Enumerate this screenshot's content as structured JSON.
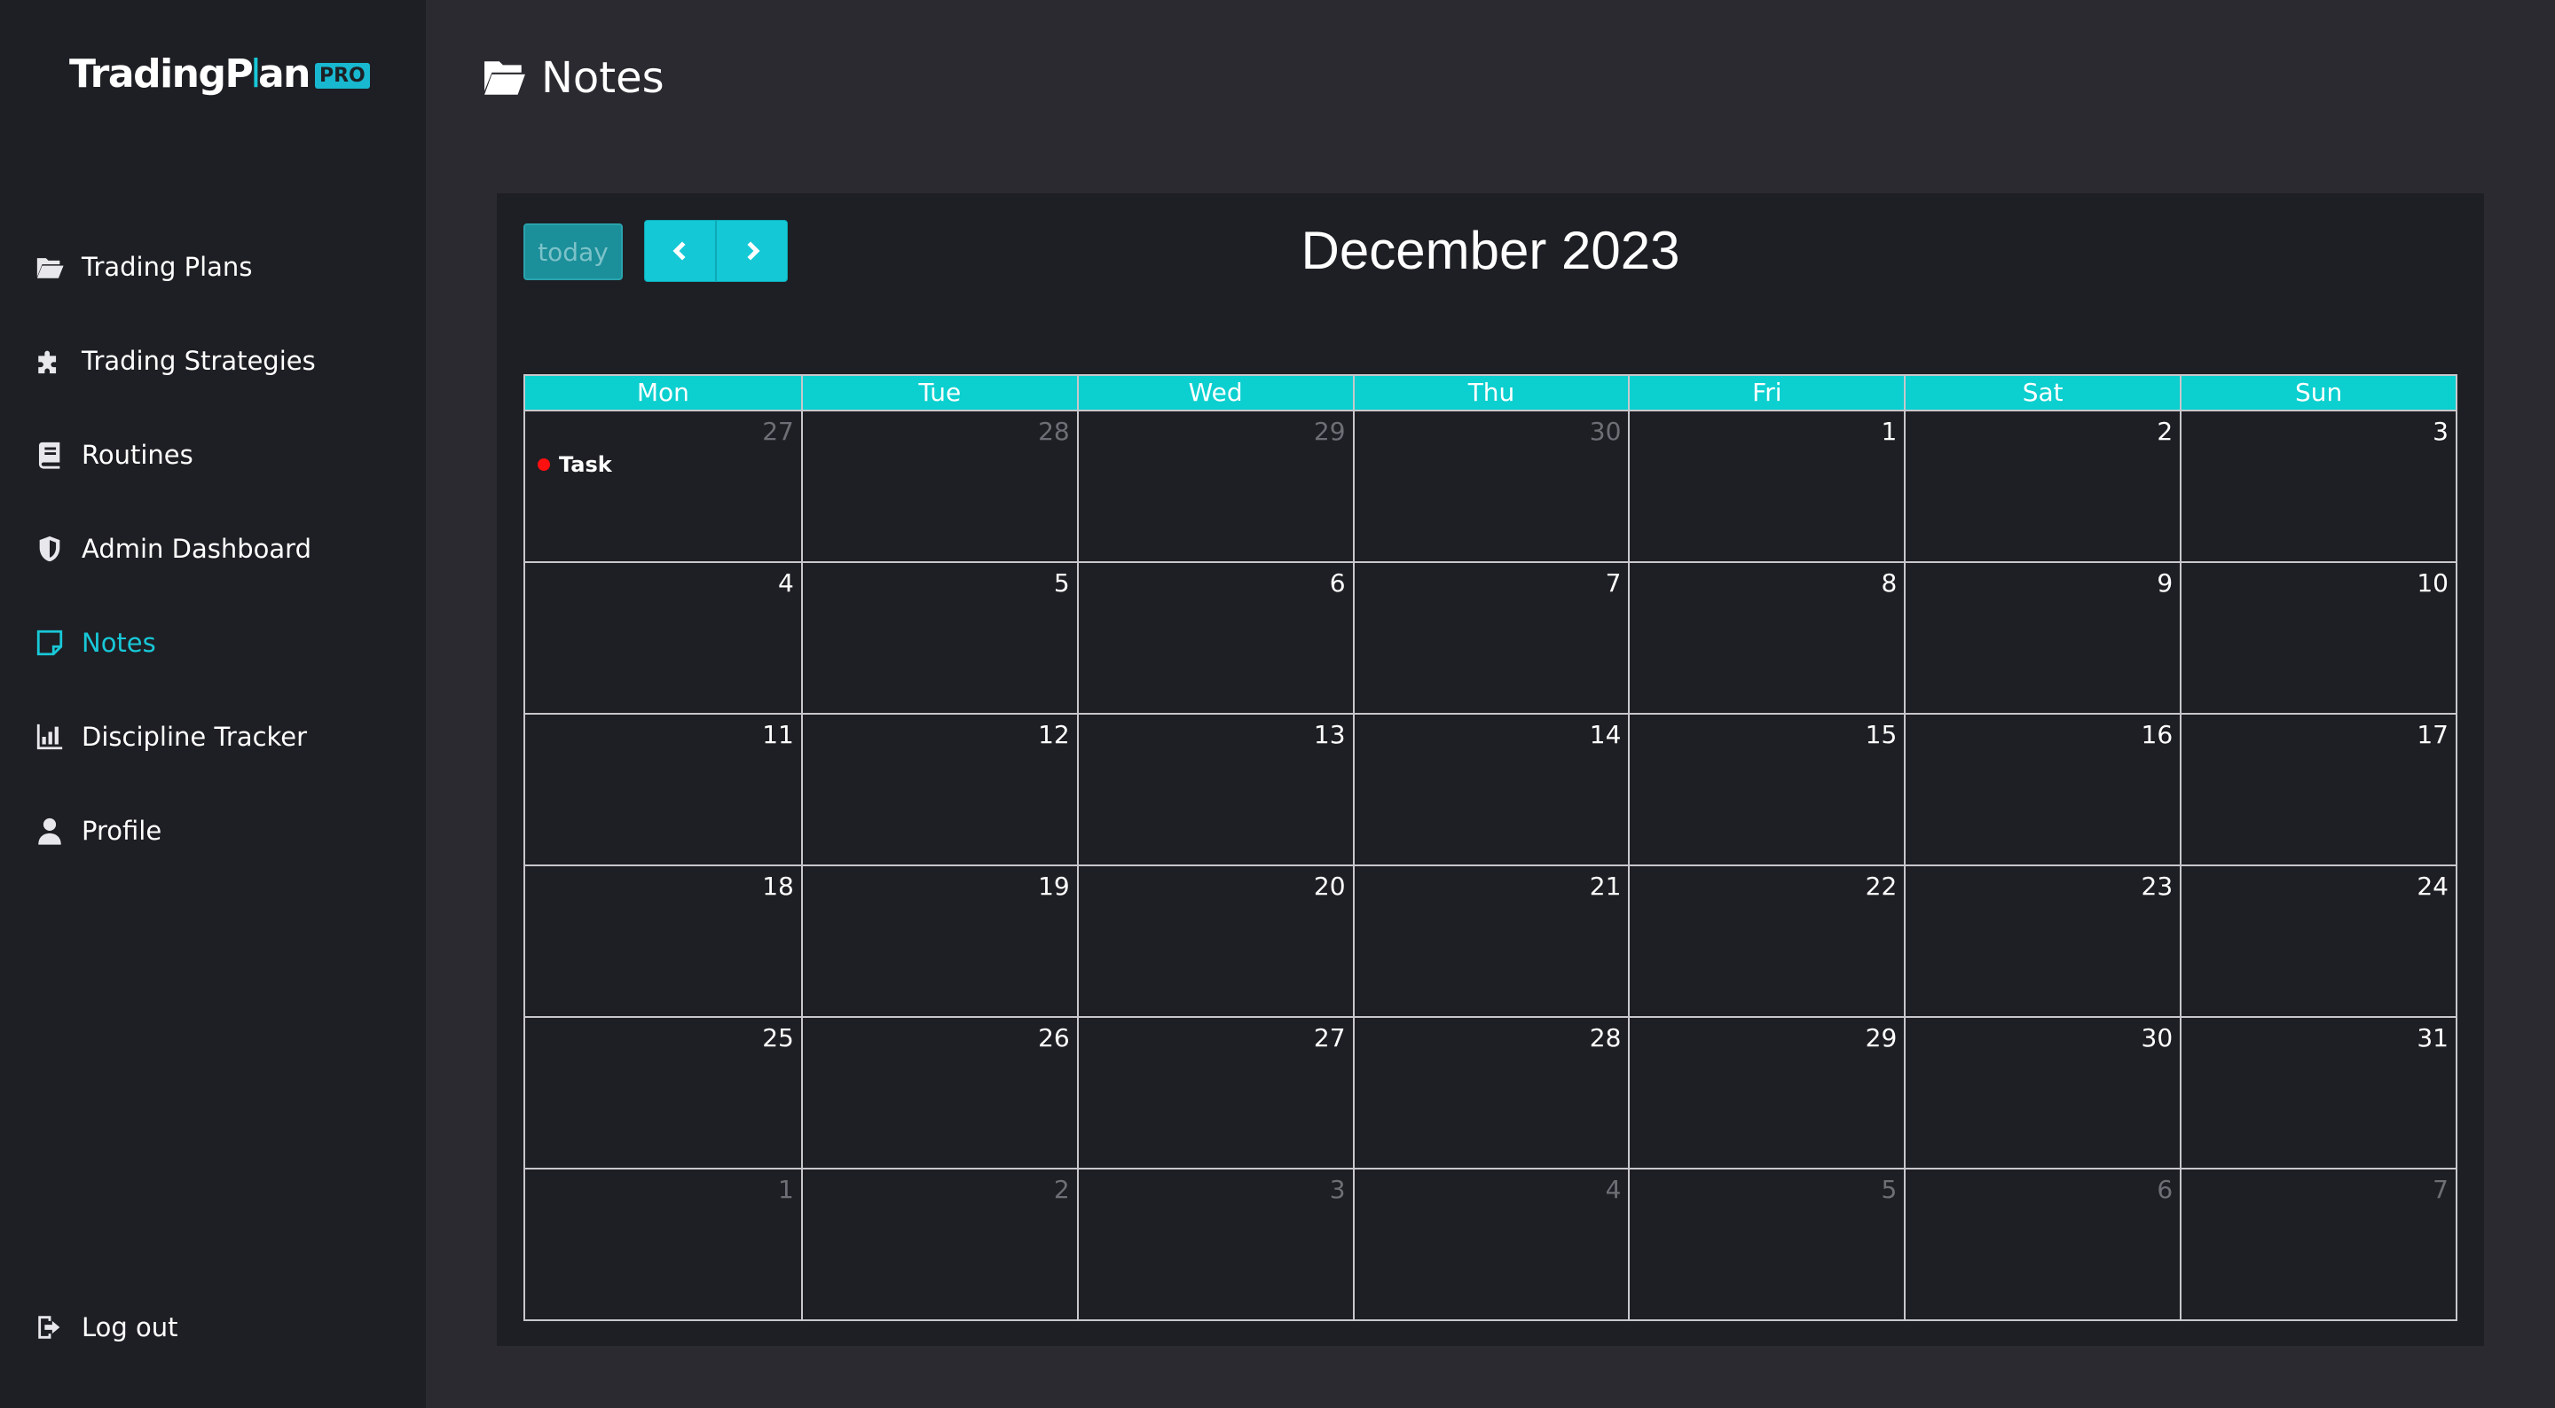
{
  "logo": {
    "text_a": "TradingP",
    "text_b": "l",
    "text_c": "an",
    "badge": "PRO"
  },
  "sidebar": {
    "items": [
      {
        "label": "Trading Plans",
        "icon": "folder-open-icon"
      },
      {
        "label": "Trading Strategies",
        "icon": "puzzle-icon"
      },
      {
        "label": "Routines",
        "icon": "book-icon"
      },
      {
        "label": "Admin Dashboard",
        "icon": "shield-icon"
      },
      {
        "label": "Notes",
        "icon": "note-icon",
        "active": true
      },
      {
        "label": "Discipline Tracker",
        "icon": "bar-chart-icon"
      },
      {
        "label": "Profile",
        "icon": "user-icon"
      }
    ],
    "logout_label": "Log out"
  },
  "header": {
    "title": "Notes"
  },
  "calendar": {
    "today_label": "today",
    "title": "December 2023",
    "weekdays": [
      "Mon",
      "Tue",
      "Wed",
      "Thu",
      "Fri",
      "Sat",
      "Sun"
    ],
    "weeks": [
      [
        "27",
        "28",
        "29",
        "30",
        "1",
        "2",
        "3"
      ],
      [
        "4",
        "5",
        "6",
        "7",
        "8",
        "9",
        "10"
      ],
      [
        "11",
        "12",
        "13",
        "14",
        "15",
        "16",
        "17"
      ],
      [
        "18",
        "19",
        "20",
        "21",
        "22",
        "23",
        "24"
      ],
      [
        "25",
        "26",
        "27",
        "28",
        "29",
        "30",
        "31"
      ],
      [
        "1",
        "2",
        "3",
        "4",
        "5",
        "6",
        "7"
      ]
    ],
    "event": {
      "label": "Task",
      "color": "#ff1010"
    }
  },
  "colors": {
    "accent": "#18c8d8",
    "header_row": "#0ccfcf",
    "sidebar_bg": "#1e1f24",
    "page_bg": "#2a2a30"
  }
}
